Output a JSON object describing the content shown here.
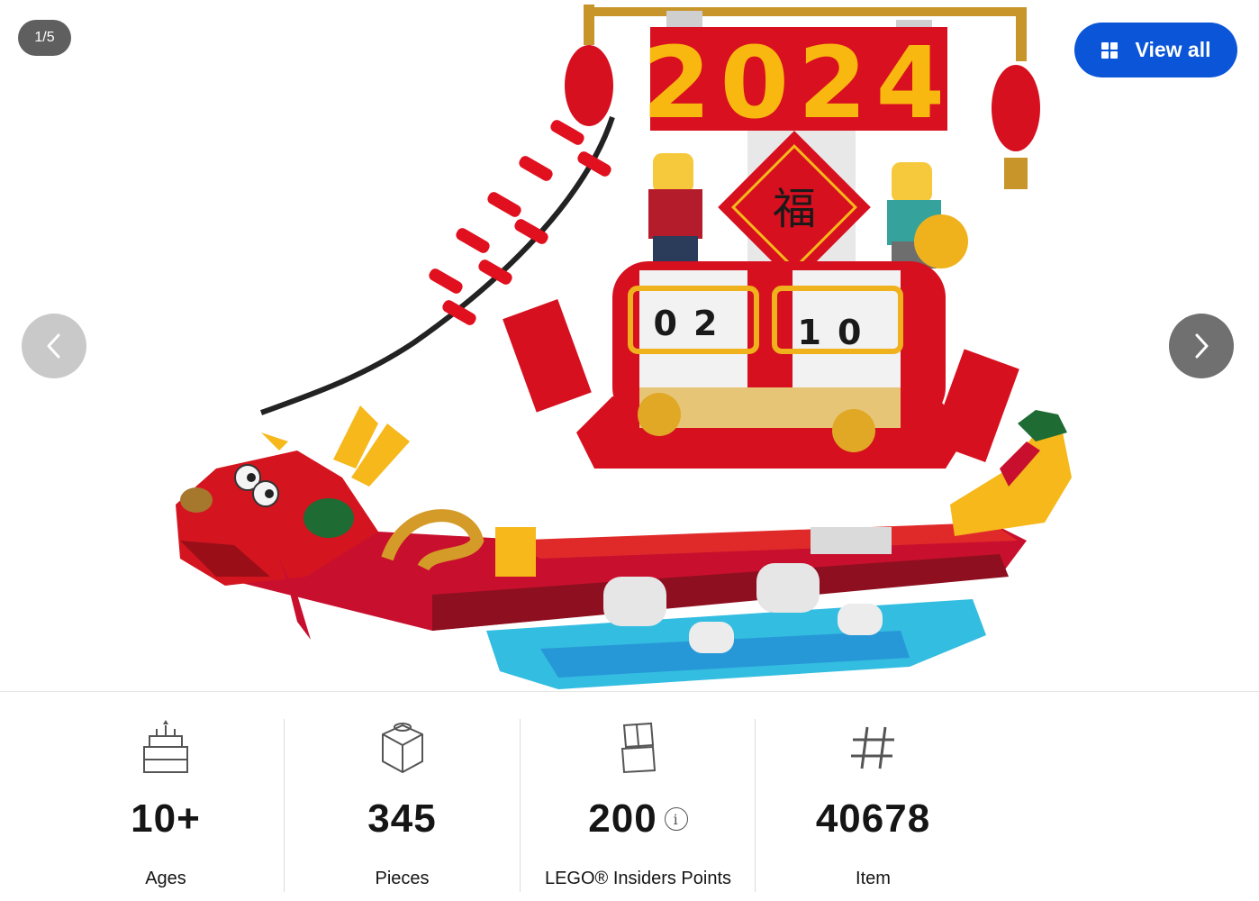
{
  "gallery": {
    "counter": "1/5",
    "view_all_label": "View all",
    "prev_icon": "chevron-left-icon",
    "next_icon": "chevron-right-icon",
    "banner_text": "2024",
    "drum_left": "02",
    "drum_right": "10",
    "character": "福"
  },
  "specs": [
    {
      "icon": "cake-icon",
      "value": "10+",
      "label": "Ages"
    },
    {
      "icon": "brick-icon",
      "value": "345",
      "label": "Pieces"
    },
    {
      "icon": "insiders-icon",
      "value": "200",
      "label": "LEGO® Insiders Points",
      "info_icon": "i"
    },
    {
      "icon": "hash-icon",
      "value": "40678",
      "label": "Item"
    }
  ]
}
